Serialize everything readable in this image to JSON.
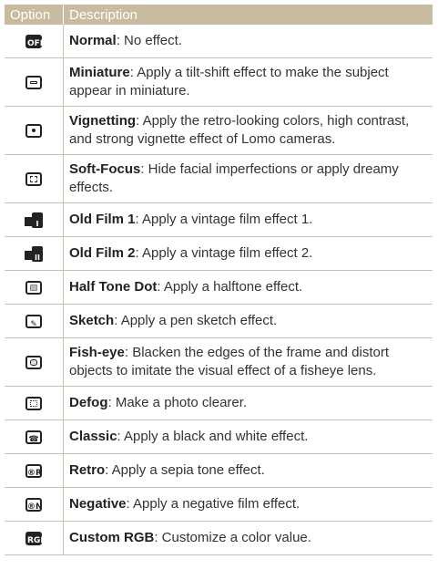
{
  "header": {
    "option": "Option",
    "description": "Description"
  },
  "rows": [
    {
      "icon": "normal-off-icon",
      "name": "Normal",
      "text": ": No effect."
    },
    {
      "icon": "miniature-icon",
      "name": "Miniature",
      "text": ": Apply a tilt-shift effect to make the subject appear in miniature."
    },
    {
      "icon": "vignetting-icon",
      "name": "Vignetting",
      "text": ": Apply the retro-looking colors, high contrast, and strong vignette effect of Lomo cameras."
    },
    {
      "icon": "soft-focus-icon",
      "name": "Soft-Focus",
      "text": ": Hide facial imperfections or apply dreamy effects."
    },
    {
      "icon": "old-film-1-icon",
      "name": "Old Film 1",
      "text": ": Apply a vintage film effect 1."
    },
    {
      "icon": "old-film-2-icon",
      "name": "Old Film 2",
      "text": ": Apply a vintage film effect 2."
    },
    {
      "icon": "half-tone-dot-icon",
      "name": "Half Tone Dot",
      "text": ": Apply a halftone effect."
    },
    {
      "icon": "sketch-icon",
      "name": "Sketch",
      "text": ": Apply a pen sketch effect."
    },
    {
      "icon": "fish-eye-icon",
      "name": "Fish-eye",
      "text": ": Blacken the edges of the frame and distort objects to imitate the visual effect of a fisheye lens."
    },
    {
      "icon": "defog-icon",
      "name": "Defog",
      "text": ": Make a photo clearer."
    },
    {
      "icon": "classic-icon",
      "name": "Classic",
      "text": ": Apply a black and white effect."
    },
    {
      "icon": "retro-icon",
      "name": "Retro",
      "text": ": Apply a sepia tone effect."
    },
    {
      "icon": "negative-icon",
      "name": "Negative",
      "text": ": Apply a negative film effect."
    },
    {
      "icon": "custom-rgb-icon",
      "name": "Custom RGB",
      "text": ": Customize a color value."
    }
  ],
  "colors": {
    "header_bg": "#c9bb9f",
    "rule": "#c9c0ad"
  }
}
